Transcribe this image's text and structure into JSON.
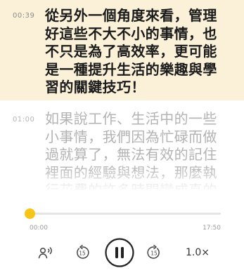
{
  "transcript": {
    "segments": [
      {
        "time": "00:39",
        "text": "從另外一個角度來看，管理好這些不大不小的事情，也不只是為了高效率，更可能是一種提升生活的樂趣與學習的關鍵技巧！",
        "active": true
      },
      {
        "time": "01:00",
        "text": "如果說工作、生活中的一些小事情，我們因為忙碌而做過就算了，無法有效的記住裡面的經驗與想法，那麼執行花費的許多時間變成真的只是花費，",
        "active": false
      }
    ]
  },
  "player": {
    "elapsed": "00:00",
    "total": "17:50",
    "progress": 0,
    "speed": "1.0×",
    "skip_back_seconds": "15",
    "skip_forward_seconds": "15",
    "state": "playing",
    "accent_color": "#f5c518",
    "icons": {
      "voice": "voice-settings-icon",
      "back": "skip-back-15-icon",
      "play": "pause-icon",
      "forward": "skip-forward-15-icon"
    }
  }
}
